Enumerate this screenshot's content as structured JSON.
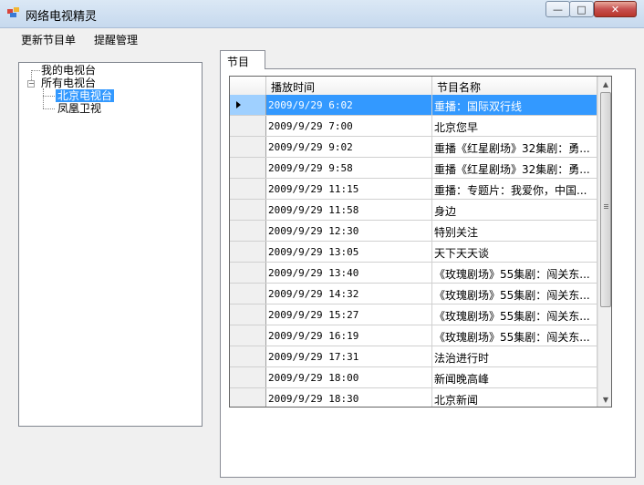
{
  "window": {
    "title": "网络电视精灵",
    "minimize_glyph": "—",
    "maximize_glyph": "□",
    "close_glyph": "✕"
  },
  "menu": {
    "items": [
      "更新节目单",
      "提醒管理"
    ]
  },
  "tree": {
    "my_tv": "我的电视台",
    "all_tv": "所有电视台",
    "all_tv_expander": "−",
    "beijing": "北京电视台",
    "phoenix": "凤凰卫视"
  },
  "tab": {
    "label": "节目"
  },
  "grid": {
    "columns": [
      "播放时间",
      "节目名称"
    ],
    "rows": [
      {
        "time": "2009/9/29 6:02",
        "name": "重播：国际双行线"
      },
      {
        "time": "2009/9/29 7:00",
        "name": "北京您早"
      },
      {
        "time": "2009/9/29 9:02",
        "name": "重播《红星剧场》32集剧：勇..."
      },
      {
        "time": "2009/9/29 9:58",
        "name": "重播《红星剧场》32集剧：勇..."
      },
      {
        "time": "2009/9/29 11:15",
        "name": "重播：专题片：我爱你，中国..."
      },
      {
        "time": "2009/9/29 11:58",
        "name": "身边"
      },
      {
        "time": "2009/9/29 12:30",
        "name": "特别关注"
      },
      {
        "time": "2009/9/29 13:05",
        "name": "天下天天谈"
      },
      {
        "time": "2009/9/29 13:40",
        "name": "《玫瑰剧场》55集剧：闯关东..."
      },
      {
        "time": "2009/9/29 14:32",
        "name": "《玫瑰剧场》55集剧：闯关东..."
      },
      {
        "time": "2009/9/29 15:27",
        "name": "《玫瑰剧场》55集剧：闯关东..."
      },
      {
        "time": "2009/9/29 16:19",
        "name": "《玫瑰剧场》55集剧：闯关东..."
      },
      {
        "time": "2009/9/29 17:31",
        "name": "法治进行时"
      },
      {
        "time": "2009/9/29 18:00",
        "name": "新闻晚高峰"
      },
      {
        "time": "2009/9/29 18:30",
        "name": "北京新闻"
      }
    ],
    "selected_row": 0,
    "scroll_up_glyph": "▲",
    "scroll_down_glyph": "▼"
  }
}
